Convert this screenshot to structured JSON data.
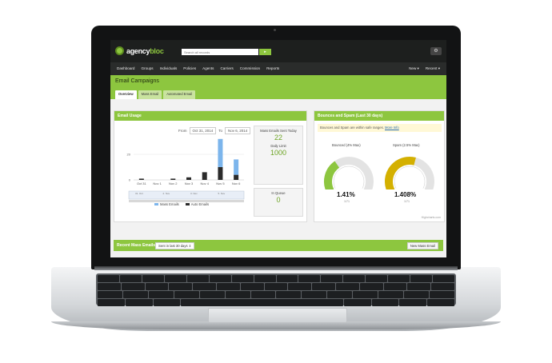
{
  "app": {
    "logo_prefix": "agency",
    "logo_suffix": "bloc",
    "search_placeholder": "Search all records",
    "search_button": "Go",
    "settings_icon": "gear-icon"
  },
  "nav": {
    "items": [
      "Dashboard",
      "Groups",
      "Individuals",
      "Policies",
      "Agents",
      "Carriers",
      "Commission",
      "Reports"
    ],
    "new_label": "New ▾",
    "recent_label": "Recent ▾"
  },
  "page": {
    "title": "Email Campaigns",
    "tabs": [
      "Overview",
      "Mass Email",
      "Automated Email"
    ],
    "active_tab": "Overview"
  },
  "email_usage": {
    "title": "Email Usage",
    "from_label": "From",
    "from_date": "Oct 31, 2014",
    "to_label": "To",
    "to_date": "Nov 6, 2014",
    "mass_sent_label": "Mass Emails Sent Today",
    "mass_sent_value": "22",
    "daily_limit_label": "Daily Limit",
    "daily_limit_value": "1000",
    "in_queue_label": "In Queue",
    "in_queue_value": "0",
    "legend_mass": "Mass Emails",
    "legend_auto": "Auto Emails",
    "navigator_labels": [
      "31. Oct",
      "2. Nov",
      "3. Nov",
      "5. Nov"
    ]
  },
  "chart_data": {
    "type": "bar",
    "categories": [
      "Oct 31",
      "Nov 1",
      "Nov 2",
      "Nov 3",
      "Nov 4",
      "Nov 5",
      "Nov 6"
    ],
    "series": [
      {
        "name": "Mass Emails",
        "values": [
          0,
          0,
          0,
          0,
          0,
          22,
          12
        ]
      },
      {
        "name": "Auto Emails",
        "values": [
          1,
          0,
          1,
          2,
          6,
          10,
          4
        ]
      }
    ],
    "stacked": true,
    "ylim": [
      0,
      35
    ],
    "yticks": [
      "20",
      "0"
    ],
    "colors": {
      "mass": "#7cb5ec",
      "auto": "#2b2b2b"
    }
  },
  "bounces": {
    "title": "Bounces and Spam (Last 30 days)",
    "notice": "Bounces and Spam are within safe ranges.",
    "more_info": "More Info",
    "gauge1_title": "Bounced (4% Max)",
    "gauge1_value": "1.41%",
    "gauge1_sub": "1/71",
    "gauge2_title": "Spam (2.5% Max)",
    "gauge2_value": "1.408%",
    "gauge2_sub": "1/71",
    "credit": "Highcharts.com"
  },
  "gauges": [
    {
      "value": 1.41,
      "max": 4,
      "color": "#8dc63f"
    },
    {
      "value": 1.408,
      "max": 2.5,
      "color": "#d4b000"
    }
  ],
  "recent": {
    "title": "Recent Mass Emails",
    "filter": "Sent in last 30 days ⇕",
    "new_button": "New Mass Email"
  }
}
